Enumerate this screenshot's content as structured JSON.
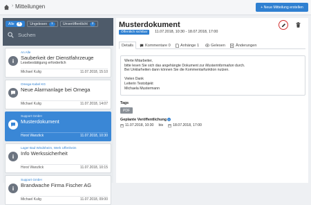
{
  "breadcrumb": {
    "title": "Mitteilungen"
  },
  "toolbar": {
    "new_label": "+ Neue Mitteilung erstellen"
  },
  "filters": [
    {
      "label": "Alle",
      "count": "6",
      "active": true
    },
    {
      "label": "Ungelesen",
      "count": "1",
      "active": false
    },
    {
      "label": "Unveröffentlicht",
      "count": "2",
      "active": false
    }
  ],
  "search": {
    "placeholder": "Suchen"
  },
  "messages": [
    {
      "sender": "An Alle",
      "subject": "Sauberkeit der Dienstfahrzeuge",
      "subtitle": "Lesebestätigung erforderlich",
      "author": "Michael Kulig",
      "date": "11.07.2018, 15:10",
      "icon": "info"
    },
    {
      "sender": "Omega Kabel KG",
      "subject": "Neue Alarmanlage bei Omega",
      "subtitle": "",
      "author": "Michael Kulig",
      "date": "11.07.2018, 14:07",
      "icon": "chat"
    },
    {
      "sender": "Support GmbH",
      "subject": "Musterdokument",
      "subtitle": "",
      "author": "Horst Wanzlick",
      "date": "11.07.2018, 10:30",
      "icon": "chat",
      "selected": true
    },
    {
      "sender": "Lager Bad Windsheim, Werk Uffenheim",
      "subject": "Info Werkssicherheit",
      "subtitle": "",
      "author": "Horst Wanzlick",
      "date": "11.07.2018, 10:15",
      "icon": "info"
    },
    {
      "sender": "Support GmbH",
      "subject": "Brandwache Firma Fischer AG",
      "subtitle": "",
      "author": "Michael Kulig",
      "date": "11.07.2018, 09:00",
      "icon": "info"
    }
  ],
  "detail": {
    "title": "Musterdokument",
    "status": "Öffentlich sichtbar",
    "daterange": "11.07.2018, 10:30 - 18.07.2018, 17:00",
    "tabs": [
      {
        "label": "Details",
        "icon": ""
      },
      {
        "label": "Kommentare 0",
        "icon": "comment-icon"
      },
      {
        "label": "Anhänge 1",
        "icon": "attachment-icon"
      },
      {
        "label": "Gelesen",
        "icon": "eye-icon"
      },
      {
        "label": "Änderungen",
        "icon": "edit-list-icon"
      }
    ],
    "body": {
      "line1": "Werte Mitarbeiter,",
      "line2_pre": "bitte lesen Sie sich das angehängte Dokument zur ",
      "line2_it": "Musterinformation",
      "line2_post": " durch.",
      "line3": "Bei Unklarheiten dann können Sie die Kommentarfunktion nutzen.",
      "line4": "",
      "line5": "Vielen Dank",
      "line6": "Leiterin Testobjekt",
      "line7": "Michaela Mustermann"
    },
    "tags_label": "Tags",
    "tag": "PDF",
    "plan_label": "Geplante Veröffentlichung",
    "plan_from": "11.07.2018, 10:30",
    "plan_sep": "bis",
    "plan_to": "18.07.2018, 17:00"
  },
  "colors": {
    "accent": "#2f80d1",
    "filterbar": "#4e5b6a",
    "edit_ring": "#d32f2f"
  }
}
